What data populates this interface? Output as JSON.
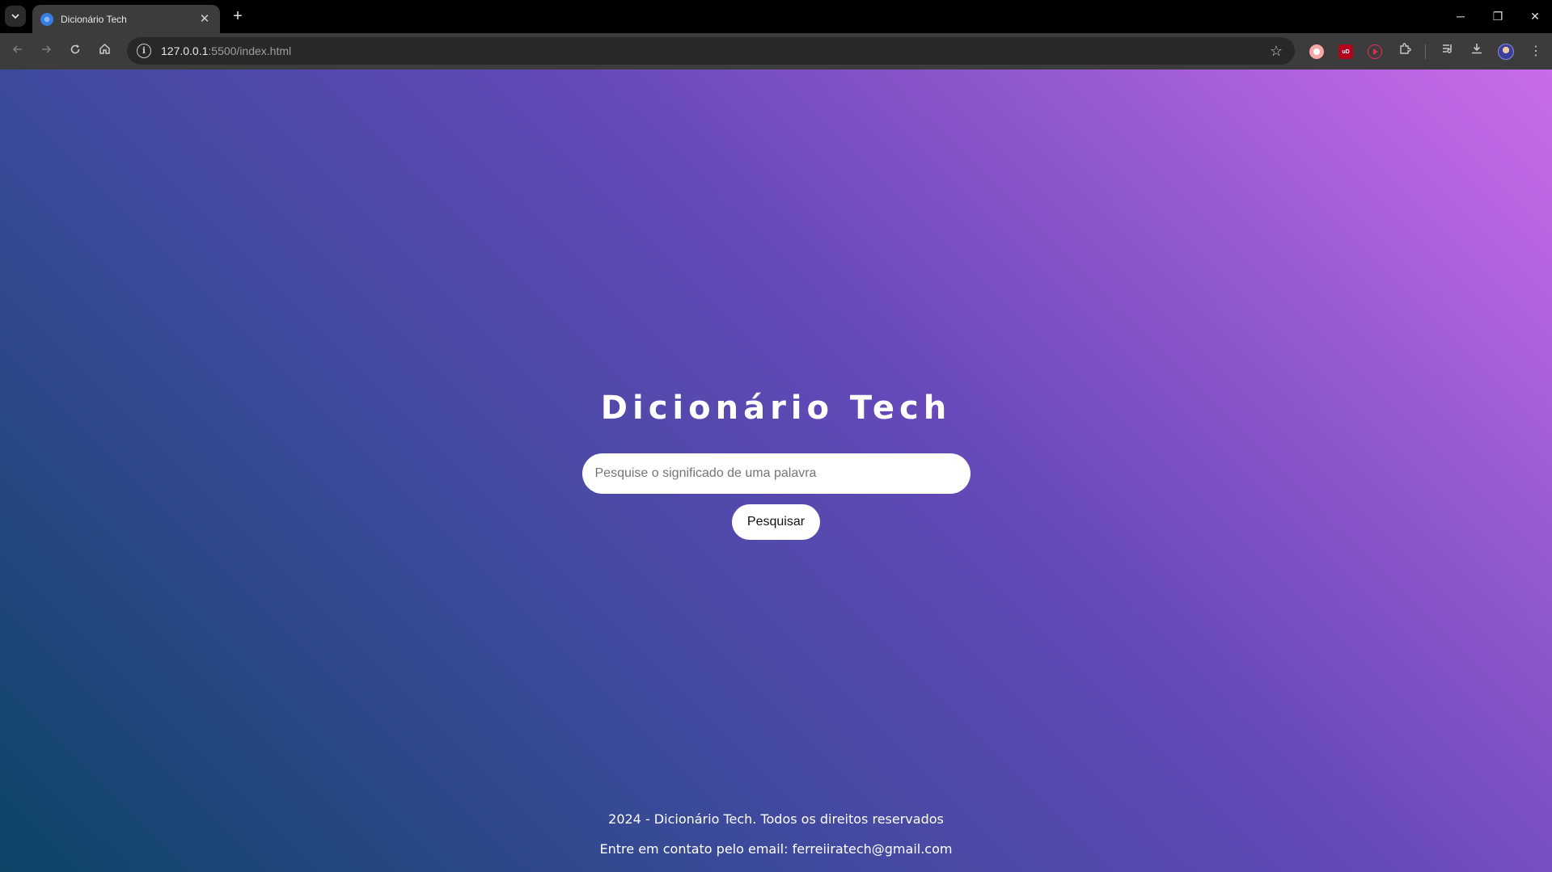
{
  "browser": {
    "tab": {
      "title": "Dicionário Tech",
      "close_glyph": "✕"
    },
    "new_tab_glyph": "+",
    "url_host": "127.0.0.1",
    "url_rest": ":5500/index.html",
    "window_controls": {
      "minimize": "─",
      "restore": "❐",
      "close": "✕"
    },
    "icons": [
      "back-arrow-icon",
      "forward-arrow-icon",
      "reload-icon",
      "home-icon",
      "site-info-icon",
      "bookmark-star-icon",
      "extensions-icon",
      "media-controls-icon",
      "download-icon",
      "profile-avatar",
      "kebab-menu-icon"
    ],
    "extension_badges": {
      "ublock": "uD"
    }
  },
  "page": {
    "title": "Dicionário Tech",
    "search": {
      "placeholder": "Pesquise o significado de uma palavra",
      "value": ""
    },
    "search_button": "Pesquisar",
    "footer": {
      "line1": "2024 - Dicionário Tech. Todos os direitos reservados",
      "line2": "Entre em contato pelo email: ferreiiratech@gmail.com"
    }
  },
  "colors": {
    "gradient_top_right": "#c96be8",
    "gradient_mid": "#6449b8",
    "gradient_bottom_left": "#0d4466",
    "chrome_toolbar": "#3c3c3c",
    "chrome_titlebar": "#000000"
  }
}
